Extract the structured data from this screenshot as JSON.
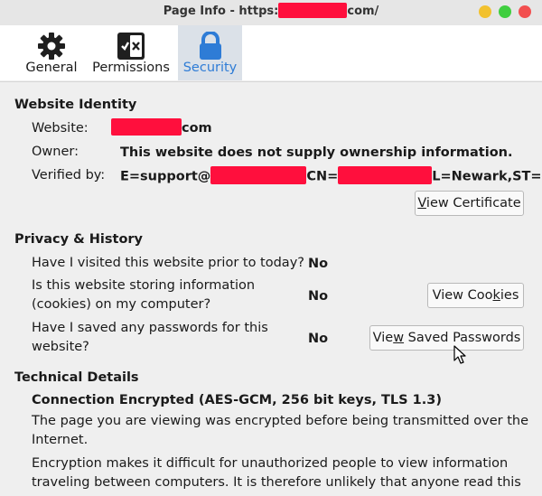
{
  "window": {
    "title_prefix": "Page Info - https:",
    "title_suffix": "com/"
  },
  "tabs": [
    {
      "label": "General",
      "icon": "gear-icon"
    },
    {
      "label": "Permissions",
      "icon": "permissions-toggle-icon"
    },
    {
      "label": "Security",
      "icon": "lock-icon",
      "selected": true
    }
  ],
  "identity": {
    "section_title": "Website Identity",
    "website_label": "Website:",
    "website_suffix": "com",
    "owner_label": "Owner:",
    "owner_value": "This website does not supply ownership information.",
    "verified_label": "Verified by:",
    "verified_part1": "E=support@",
    "verified_part2": "CN=",
    "verified_part3": "L=Newark,ST=NJ",
    "view_certificate": {
      "pre": "",
      "accel": "V",
      "post": "iew Certificate"
    }
  },
  "privacy": {
    "section_title": "Privacy & History",
    "q1": "Have I visited this website prior to today?",
    "a1": "No",
    "q2_line1": "Is this website storing information",
    "q2_line2": "(cookies) on my computer?",
    "a2": "No",
    "view_cookies": {
      "pre": "View Coo",
      "accel": "k",
      "post": "ies"
    },
    "q3_line1": "Have I saved any passwords for this",
    "q3_line2": "website?",
    "a3": "No",
    "view_passwords": {
      "pre": "Vie",
      "accel": "w",
      "post": " Saved Passwords"
    }
  },
  "technical": {
    "section_title": "Technical Details",
    "connection": "Connection Encrypted (AES-GCM, 256 bit keys, TLS 1.3)",
    "para1_line1": "The page you are viewing was encrypted before being transmitted over the",
    "para1_line2": "Internet.",
    "para2_line1": "Encryption makes it difficult for unauthorized people to view information",
    "para2_line2": "traveling between computers. It is therefore unlikely that anyone read this"
  },
  "colors": {
    "accent": "#2e7cd6",
    "redaction": "#ff0f3d",
    "selected_tab_bg": "#dbe1e8"
  }
}
